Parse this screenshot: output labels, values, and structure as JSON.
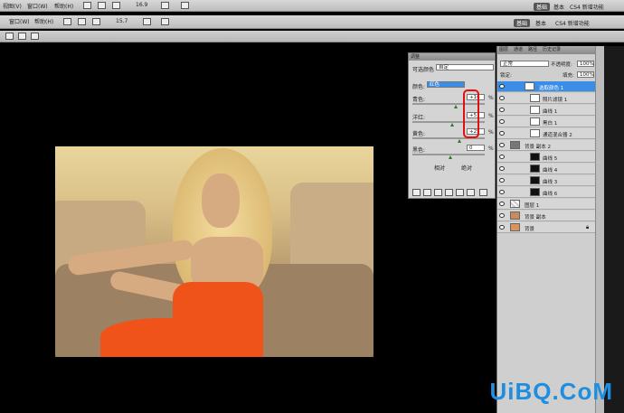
{
  "menubar": {
    "items": [
      "视图(V)",
      "窗口(W)",
      "帮助(H)"
    ],
    "zoom": "16.9",
    "workspaces": [
      "基础",
      "基本",
      "CS4 新增功能"
    ]
  },
  "optbar": {
    "items": [
      "窗口(W)",
      "帮助(H)"
    ],
    "zoom": "15.7",
    "workspaces": [
      "基础",
      "基本",
      "CS4 新增功能"
    ]
  },
  "adjustments": {
    "tab": "调整",
    "preset_label": "可选颜色",
    "preset_value": "自定",
    "color_label": "颜色:",
    "color_value": "红色",
    "sliders": [
      {
        "label": "青色:",
        "value": "+16",
        "pct": "%"
      },
      {
        "label": "洋红:",
        "value": "+5",
        "pct": "%"
      },
      {
        "label": "黄色:",
        "value": "+25",
        "pct": "%"
      },
      {
        "label": "黑色:",
        "value": "0",
        "pct": "%"
      }
    ],
    "radio_relative": "相对",
    "radio_absolute": "绝对"
  },
  "layers": {
    "tabs": [
      "图层",
      "通道",
      "路径",
      "历史记录"
    ],
    "blend_mode": "正常",
    "opacity_label": "不透明度:",
    "opacity": "100%",
    "lock_label": "锁定:",
    "fill_label": "填充:",
    "fill": "100%",
    "rows": [
      {
        "name": "选取颜色 1"
      },
      {
        "name": "照片滤镜 1"
      },
      {
        "name": "曲线 1"
      },
      {
        "name": "黑白 1"
      },
      {
        "name": "通道混合器 2"
      },
      {
        "name": "背景 副本 2"
      },
      {
        "name": "曲线 5"
      },
      {
        "name": "曲线 4"
      },
      {
        "name": "曲线 3"
      },
      {
        "name": "曲线 6"
      },
      {
        "name": "图层 1"
      },
      {
        "name": "背景 副本"
      },
      {
        "name": "背景"
      }
    ]
  },
  "watermark": "UiBQ.CoM",
  "colors": {
    "accent": "#3a8ee8",
    "annotation": "#e01010",
    "watermark": "#1e8ee0"
  }
}
